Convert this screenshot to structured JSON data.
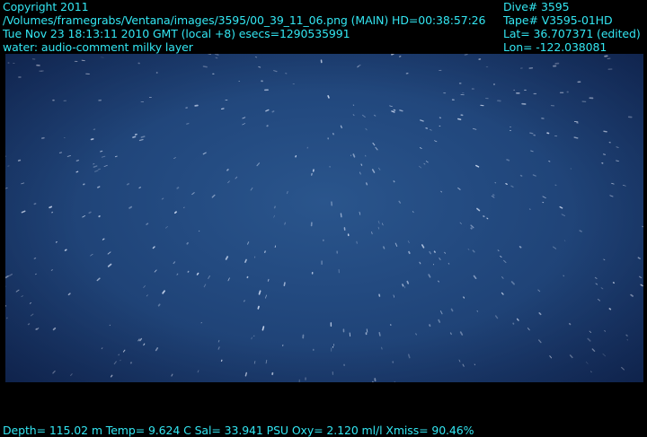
{
  "overlay": {
    "copyright": "Copyright 2011",
    "filepath": "/Volumes/framegrabs/Ventana/images/3595/00_39_11_06.png (MAIN)  HD=00:38:57:26",
    "datetime": "Tue Nov 23 18:13:11 2010 GMT (local +8)  esecs=1290535991",
    "water": "water: audio-comment milky layer",
    "dive": "Dive# 3595",
    "tape": "Tape# V3595-01HD",
    "lat": "Lat= 36.707371 (edited)",
    "lon": "Lon= -122.038081",
    "sensors": "Depth= 115.02 m  Temp= 9.624 C  Sal= 33.941 PSU  Oxy= 2.120 ml/l  Xmiss= 90.46%"
  },
  "colors": {
    "overlay_text": "#33e6f2",
    "water_center": "#2a558c",
    "water_edge": "#173564",
    "background": "#000000"
  }
}
